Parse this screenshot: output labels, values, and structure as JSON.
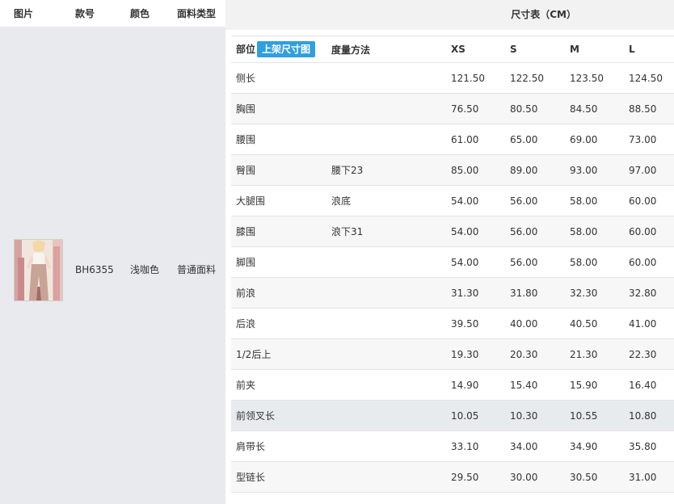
{
  "left_table": {
    "headers": [
      "图片",
      "款号",
      "颜色",
      "面料类型"
    ],
    "product": {
      "style_no": "BH6355",
      "color_name": "浅咖色",
      "fabric_type": "普通面料"
    }
  },
  "size_chart": {
    "title": "尺寸表（CM）",
    "col_part": "部位",
    "badge": "上架尺寸图",
    "col_method": "度量方法",
    "sizes": [
      "XS",
      "S",
      "M",
      "L"
    ],
    "rows": [
      {
        "part": "侧长",
        "method": "",
        "values": [
          "121.50",
          "122.50",
          "123.50",
          "124.50"
        ]
      },
      {
        "part": "胸围",
        "method": "",
        "values": [
          "76.50",
          "80.50",
          "84.50",
          "88.50"
        ]
      },
      {
        "part": "腰围",
        "method": "",
        "values": [
          "61.00",
          "65.00",
          "69.00",
          "73.00"
        ]
      },
      {
        "part": "臀围",
        "method": "腰下23",
        "values": [
          "85.00",
          "89.00",
          "93.00",
          "97.00"
        ]
      },
      {
        "part": "大腿围",
        "method": "浪底",
        "values": [
          "54.00",
          "56.00",
          "58.00",
          "60.00"
        ]
      },
      {
        "part": "膝围",
        "method": "浪下31",
        "values": [
          "54.00",
          "56.00",
          "58.00",
          "60.00"
        ]
      },
      {
        "part": "脚围",
        "method": "",
        "values": [
          "54.00",
          "56.00",
          "58.00",
          "60.00"
        ]
      },
      {
        "part": "前浪",
        "method": "",
        "values": [
          "31.30",
          "31.80",
          "32.30",
          "32.80"
        ]
      },
      {
        "part": "后浪",
        "method": "",
        "values": [
          "39.50",
          "40.00",
          "40.50",
          "41.00"
        ]
      },
      {
        "part": "1/2后上",
        "method": "",
        "values": [
          "19.30",
          "20.30",
          "21.30",
          "22.30"
        ]
      },
      {
        "part": "前夹",
        "method": "",
        "values": [
          "14.90",
          "15.40",
          "15.90",
          "16.40"
        ]
      },
      {
        "part": "前领叉长",
        "method": "",
        "values": [
          "10.05",
          "10.30",
          "10.55",
          "10.80"
        ]
      },
      {
        "part": "肩带长",
        "method": "",
        "values": [
          "33.10",
          "34.00",
          "34.90",
          "35.80"
        ]
      },
      {
        "part": "型链长",
        "method": "",
        "values": [
          "29.50",
          "30.00",
          "30.50",
          "31.00"
        ]
      }
    ]
  },
  "colors": {
    "accent": "#2f9fdf",
    "left_bg": "#e8eaed",
    "header_bg": "#f2f2f2",
    "row_alt": "#f7f7f7",
    "row_highlight": "#e8ebee"
  }
}
